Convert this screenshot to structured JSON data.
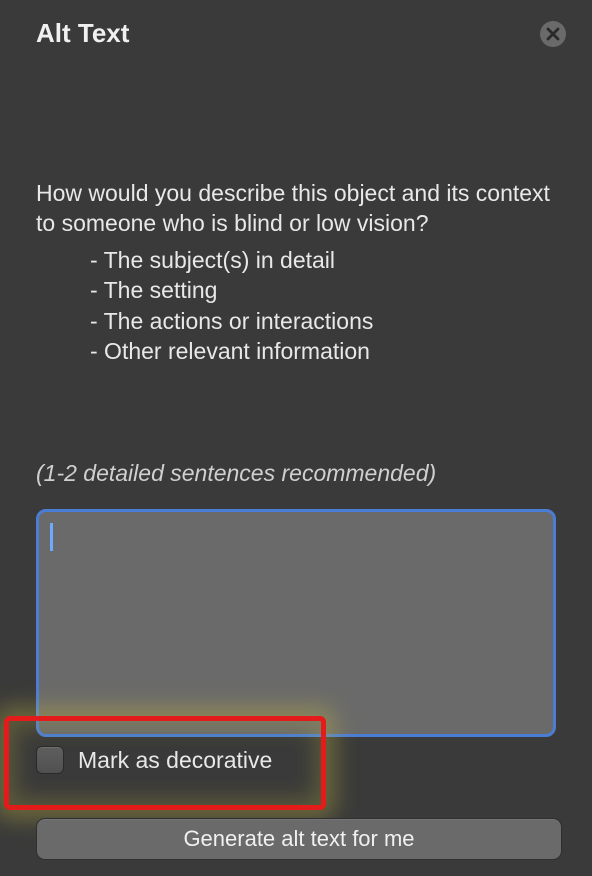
{
  "header": {
    "title": "Alt Text"
  },
  "content": {
    "prompt": "How would you describe this object and its context to someone who is blind or low vision?",
    "bullets": [
      "- The subject(s) in detail",
      "- The setting",
      "- The actions or interactions",
      "- Other relevant information"
    ],
    "recommend": "(1-2 detailed sentences recommended)",
    "textarea_value": ""
  },
  "decorative": {
    "label": "Mark as decorative",
    "checked": false
  },
  "generate": {
    "label": "Generate alt text for me"
  }
}
